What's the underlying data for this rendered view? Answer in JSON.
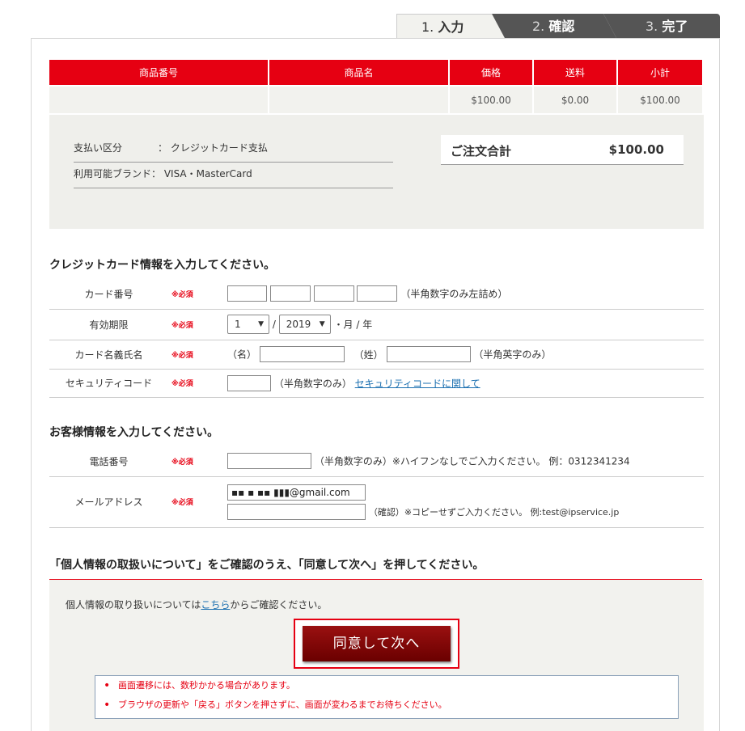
{
  "steps": [
    {
      "num": "1.",
      "label": "入力"
    },
    {
      "num": "2.",
      "label": "確認"
    },
    {
      "num": "3.",
      "label": "完了"
    }
  ],
  "order": {
    "headers": [
      "商品番号",
      "商品名",
      "価格",
      "送料",
      "小計"
    ],
    "row": [
      "",
      "",
      "$100.00",
      "$0.00",
      "$100.00"
    ]
  },
  "payment": {
    "method_label": "支払い区分",
    "method_value": "： クレジットカード支払",
    "brand_label": "利用可能ブランド：",
    "brand_value": "VISA・MasterCard",
    "total_label": "ご注文合計",
    "total_value": "$100.00"
  },
  "card_section": {
    "title": "クレジットカード情報を入力してください。",
    "required": "※必須",
    "number_label": "カード番号",
    "number_note": "（半角数字のみ左詰め）",
    "expiry_label": "有効期限",
    "expiry_month": "1",
    "expiry_slash": "/",
    "expiry_year": "2019",
    "expiry_unit": "・月 / 年",
    "name_label": "カード名義氏名",
    "first_name_label": "（名）",
    "last_name_label": "（姓）",
    "name_note": "（半角英字のみ）",
    "security_label": "セキュリティコード",
    "security_note": "（半角数字のみ）",
    "security_link": "セキュリティコードに関して"
  },
  "customer_section": {
    "title": "お客様情報を入力してください。",
    "required": "※必須",
    "phone_label": "電話番号",
    "phone_note": "（半角数字のみ）※ハイフンなしでご入力ください。 例：0312341234",
    "email_label": "メールアドレス",
    "email_value": "▪▪ ▪ ▪▪ ▮▮▮@gmail.com",
    "email_confirm_note": "（確認）※コピーせずご入力ください。 例:test@ipservice.jp"
  },
  "consent": {
    "title": "「個人情報の取扱いについて」をご確認のうえ、「同意して次へ」を押してください。",
    "text_before": "個人情報の取り扱いについては",
    "link": "こちら",
    "text_after": "からご確認ください。",
    "button": "同意して次へ",
    "notes": [
      "画面遷移には、数秒かかる場合があります。",
      "ブラウザの更新や「戻る」ボタンを押さずに、画面が変わるまでお待ちください。"
    ]
  },
  "colors": {
    "accent": "#e60012",
    "button": "#7a0000"
  }
}
